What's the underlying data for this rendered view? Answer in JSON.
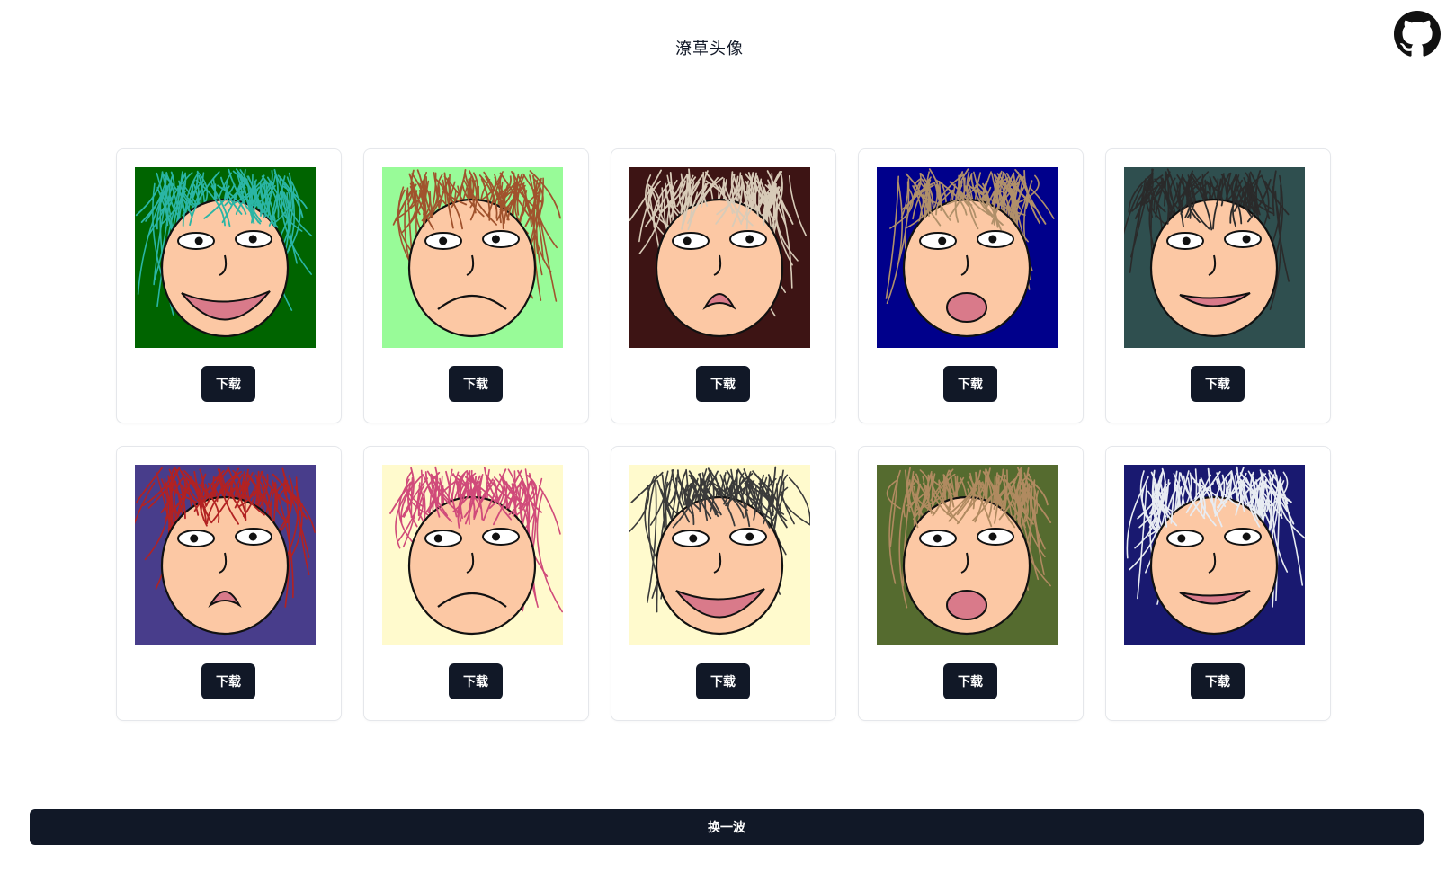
{
  "header": {
    "title": "潦草头像",
    "github_icon": "github-icon"
  },
  "avatars": [
    {
      "download_label": "下载",
      "bg": "#006400",
      "hair": "#2ab5a5",
      "mouth": "open-smile"
    },
    {
      "download_label": "下载",
      "bg": "#98fb98",
      "hair": "#a0522d",
      "mouth": "frown"
    },
    {
      "download_label": "下载",
      "bg": "#3d1414",
      "hair": "#d8cbb8",
      "mouth": "small-frown"
    },
    {
      "download_label": "下载",
      "bg": "#00008b",
      "hair": "#b0906a",
      "mouth": "o"
    },
    {
      "download_label": "下载",
      "bg": "#2f4f4f",
      "hair": "#2a2a2a",
      "mouth": "smile"
    },
    {
      "download_label": "下载",
      "bg": "#483d8b",
      "hair": "#b22222",
      "mouth": "small-frown"
    },
    {
      "download_label": "下载",
      "bg": "#fffacd",
      "hair": "#d04a7a",
      "mouth": "frown"
    },
    {
      "download_label": "下载",
      "bg": "#fffacd",
      "hair": "#3a3a3a",
      "mouth": "open-smile"
    },
    {
      "download_label": "下载",
      "bg": "#556b2f",
      "hair": "#b08a60",
      "mouth": "o"
    },
    {
      "download_label": "下载",
      "bg": "#191970",
      "hair": "#e8ecf2",
      "mouth": "smile"
    }
  ],
  "refresh_label": "换一波",
  "colors": {
    "button_bg": "#111827",
    "skin": "#fcc8a4",
    "mouth": "#d97a8a"
  }
}
